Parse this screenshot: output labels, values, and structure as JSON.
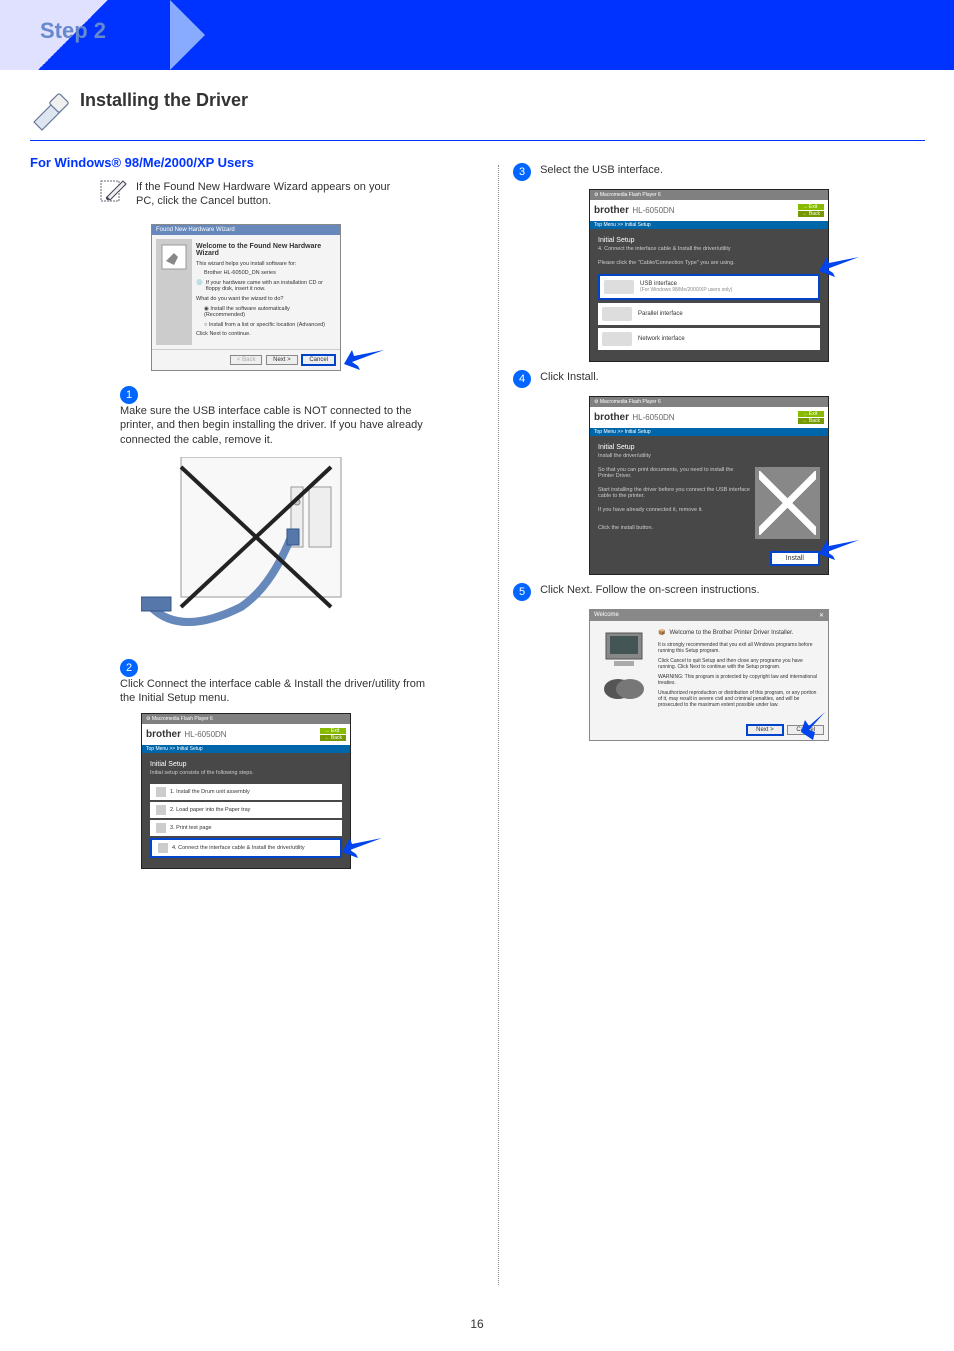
{
  "banner": {
    "step": "Step 2"
  },
  "section_title": "Installing the Driver",
  "left": {
    "os_heading": "For Windows® 98/Me/2000/XP Users",
    "note": "If the Found New Hardware Wizard appears on your PC, click the Cancel button.",
    "wizard": {
      "header": "Found New Hardware Wizard",
      "title": "Welcome to the Found New Hardware Wizard",
      "line1": "This wizard helps you install software for:",
      "device": "Brother HL-6050D_DN series",
      "cd_note": "If your hardware came with an installation CD or floppy disk, insert it now.",
      "q": "What do you want the wizard to do?",
      "opt1": "Install the software automatically (Recommended)",
      "opt2": "Install from a list or specific location (Advanced)",
      "footer": "Click Next to continue.",
      "back": "< Back",
      "next": "Next >",
      "cancel": "Cancel"
    },
    "step1": "Make sure the USB interface cable is NOT connected to the printer, and then begin installing the driver. If you have already connected the cable, remove it.",
    "step2": "Click Connect the interface cable & Install the driver/utility from the Initial Setup menu.",
    "initial_dlg": {
      "top": "Macromedia Flash Player 6",
      "brand": "brother",
      "model": "HL-6050DN",
      "exit": "Exit",
      "back": "Back",
      "nav": "Top Menu >> Initial Setup",
      "title": "Initial Setup",
      "sub": "Initial setup consists of the following steps.",
      "items": [
        "1. Install the Drum unit assembly",
        "2. Load paper into the Paper tray",
        "3. Print test page",
        "4. Connect the interface cable & Install the driver/utility"
      ]
    }
  },
  "right": {
    "step3": "Select the USB interface.",
    "iface_dlg": {
      "top": "Macromedia Flash Player 6",
      "brand": "brother",
      "model": "HL-6050DN",
      "exit": "Exit",
      "back": "Back",
      "nav": "Top Menu >> Initial Setup",
      "title": "Initial Setup",
      "sub": "4. Connect the interface cable & Install the driver/utility",
      "instruction": "Please click the \"Cable/Connection Type\" you are using.",
      "usb_title": "USB interface",
      "usb_sub": "(For Windows 98/Me/2000/XP users only)",
      "parallel": "Parallel interface",
      "network": "Network interface"
    },
    "step4": "Click Install.",
    "install_dlg": {
      "top": "Macromedia Flash Player 6",
      "brand": "brother",
      "model": "HL-6050DN",
      "exit": "Exit",
      "back": "Back",
      "nav": "Top Menu >> Initial Setup",
      "title": "Initial Setup",
      "sub": "Install the driver/utility",
      "line1": "So that you can print documents, you need to install the Printer Driver.",
      "line2": "Start installing the driver before you connect the USB interface cable to the printer.",
      "line3": "If you have already connected it, remove it.",
      "hint": "Click the install button.",
      "install": "Install"
    },
    "step5": "Click Next. Follow the on-screen instructions.",
    "welcome_dlg": {
      "top": "Welcome",
      "title": "Welcome to the Brother Printer Driver Installer.",
      "line1": "It is strongly recommended that you exit all Windows programs before running this Setup program.",
      "line2": "Click Cancel to quit Setup and then close any programs you have running. Click Next to continue with the Setup program.",
      "line3": "WARNING: This program is protected by copyright law and international treaties.",
      "line4": "Unauthorized reproduction or distribution of this program, or any portion of it, may result in severe civil and criminal penalties, and will be prosecuted to the maximum extent possible under law.",
      "next": "Next >",
      "cancel": "Cancel"
    }
  },
  "page_num": "16"
}
